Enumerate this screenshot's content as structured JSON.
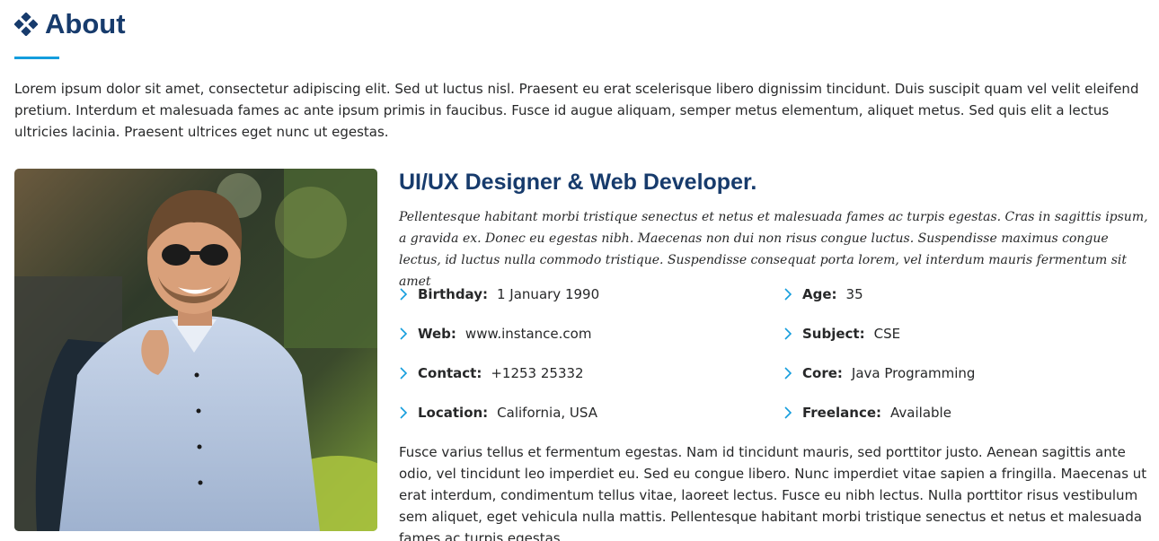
{
  "section": {
    "title": "About",
    "icon": "diamond-grid-icon"
  },
  "intro": "Lorem ipsum dolor sit amet, consectetur adipiscing elit. Sed ut luctus nisl. Praesent eu erat scelerisque libero dignissim tincidunt. Duis suscipit quam vel velit eleifend pretium. Interdum et malesuada fames ac ante ipsum primis in faucibus. Fusce id augue aliquam, semper metus elementum, aliquet metus. Sed quis elit a lectus ultricies lacinia. Praesent ultrices eget nunc ut egestas.",
  "role": "UI/UX Designer & Web Developer.",
  "lead": "Pellentesque habitant morbi tristique senectus et netus et malesuada fames ac turpis egestas. Cras in sagittis ipsum, a gravida ex. Donec eu egestas nibh. Maecenas non dui non risus congue luctus. Suspendisse maximus congue lectus, id luctus nulla commodo tristique. Suspendisse consequat porta lorem, vel interdum mauris fermentum sit amet",
  "facts": {
    "birthday": {
      "label": "Birthday:",
      "value": "1 January 1990"
    },
    "age": {
      "label": "Age:",
      "value": "35"
    },
    "web": {
      "label": "Web:",
      "value": "www.instance.com"
    },
    "subject": {
      "label": "Subject:",
      "value": "CSE"
    },
    "contact": {
      "label": "Contact:",
      "value": "+1253 25332"
    },
    "core": {
      "label": "Core:",
      "value": "Java Programming"
    },
    "location": {
      "label": "Location:",
      "value": "California, USA"
    },
    "freelance": {
      "label": "Freelance:",
      "value": "Available"
    }
  },
  "outro": "Fusce varius tellus et fermentum egestas. Nam id tincidunt mauris, sed porttitor justo. Aenean sagittis ante odio, vel tincidunt leo imperdiet eu. Sed eu congue libero. Nunc imperdiet vitae sapien a fringilla. Maecenas ut erat interdum, condimentum tellus vitae, laoreet lectus. Fusce eu nibh lectus. Nulla porttitor risus vestibulum sem aliquet, eget vehicula nulla mattis. Pellentesque habitant morbi tristique senectus et netus et malesuada fames ac turpis egestas",
  "colors": {
    "heading": "#173b6c",
    "accent": "#149ddd",
    "text": "#272829"
  }
}
